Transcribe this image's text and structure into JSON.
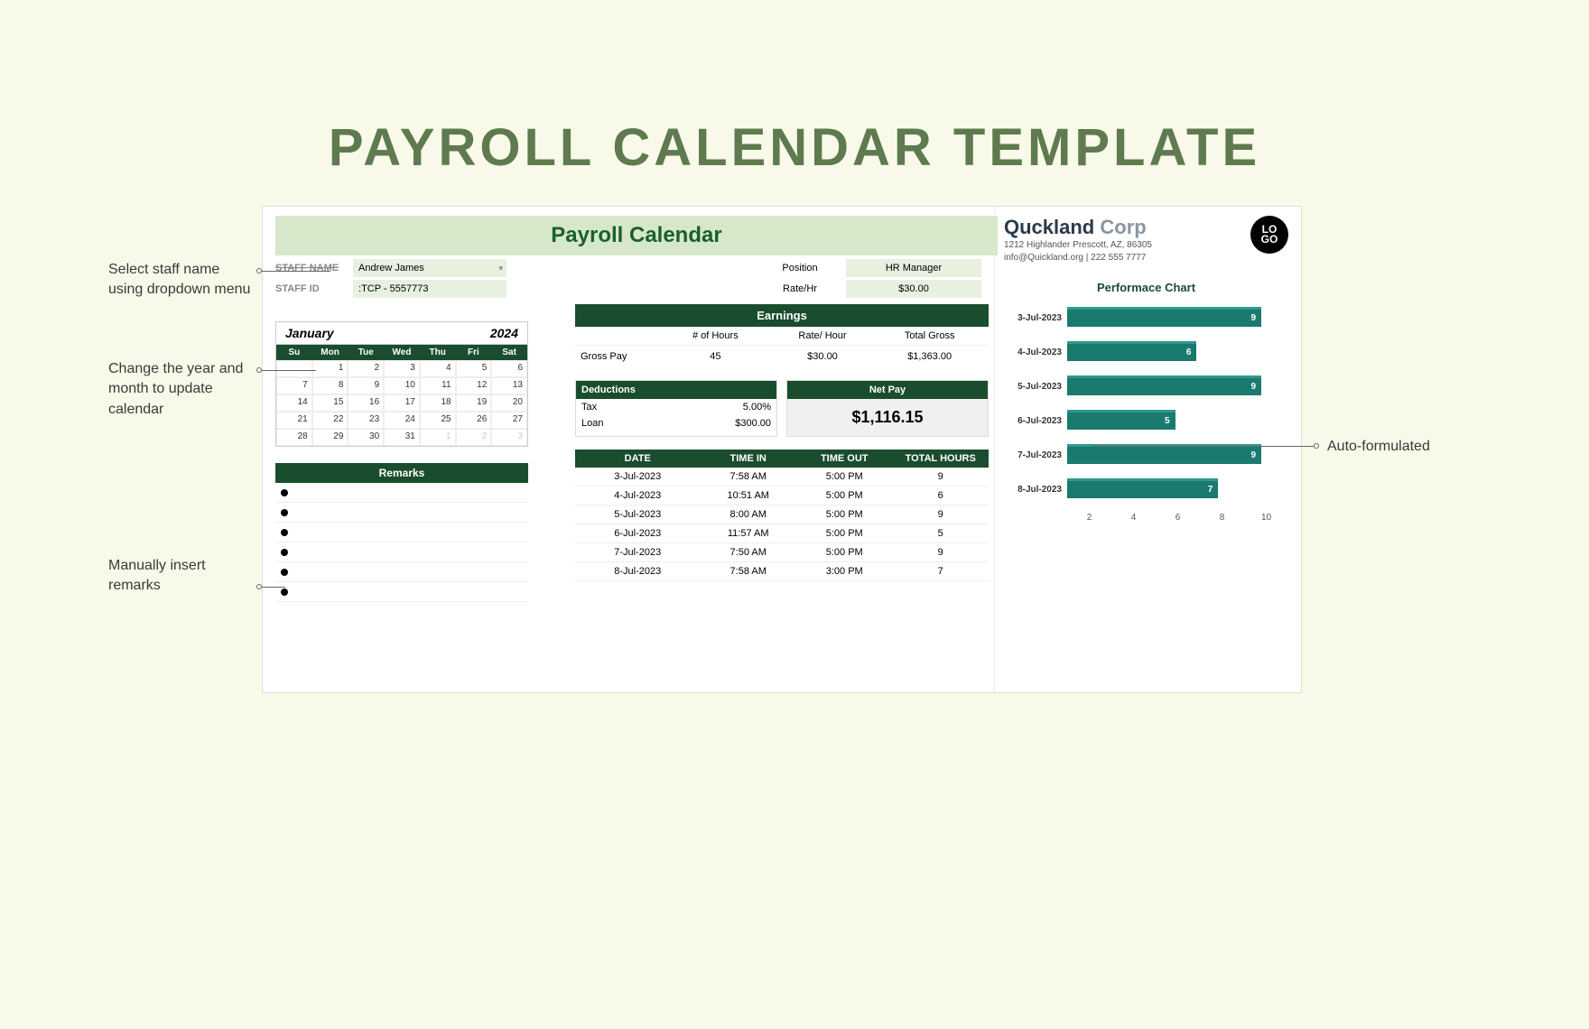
{
  "page_title": "PAYROLL CALENDAR TEMPLATE",
  "banner": "Payroll Calendar",
  "staff": {
    "name_label": "STAFF NAME",
    "name_value": "Andrew James",
    "id_label": "STAFF ID",
    "id_value": "TCP - 5557773"
  },
  "position": {
    "pos_label": "Position",
    "pos_value": "HR Manager",
    "rate_label": "Rate/Hr",
    "rate_value": "$30.00"
  },
  "calendar": {
    "month": "January",
    "year": "2024",
    "days": [
      "Su",
      "Mon",
      "Tue",
      "Wed",
      "Thu",
      "Fri",
      "Sat"
    ],
    "cells": [
      {
        "v": "",
        "d": false
      },
      {
        "v": "1",
        "d": false
      },
      {
        "v": "2",
        "d": false
      },
      {
        "v": "3",
        "d": false
      },
      {
        "v": "4",
        "d": false
      },
      {
        "v": "5",
        "d": false
      },
      {
        "v": "6",
        "d": false
      },
      {
        "v": "7",
        "d": false
      },
      {
        "v": "8",
        "d": false
      },
      {
        "v": "9",
        "d": false
      },
      {
        "v": "10",
        "d": false
      },
      {
        "v": "11",
        "d": false
      },
      {
        "v": "12",
        "d": false
      },
      {
        "v": "13",
        "d": false
      },
      {
        "v": "14",
        "d": false
      },
      {
        "v": "15",
        "d": false
      },
      {
        "v": "16",
        "d": false
      },
      {
        "v": "17",
        "d": false
      },
      {
        "v": "18",
        "d": false
      },
      {
        "v": "19",
        "d": false
      },
      {
        "v": "20",
        "d": false
      },
      {
        "v": "21",
        "d": false
      },
      {
        "v": "22",
        "d": false
      },
      {
        "v": "23",
        "d": false
      },
      {
        "v": "24",
        "d": false
      },
      {
        "v": "25",
        "d": false
      },
      {
        "v": "26",
        "d": false
      },
      {
        "v": "27",
        "d": false
      },
      {
        "v": "28",
        "d": false
      },
      {
        "v": "29",
        "d": false
      },
      {
        "v": "30",
        "d": false
      },
      {
        "v": "31",
        "d": false
      },
      {
        "v": "1",
        "d": true
      },
      {
        "v": "2",
        "d": true
      },
      {
        "v": "3",
        "d": true
      }
    ]
  },
  "remarks_title": "Remarks",
  "earnings": {
    "title": "Earnings",
    "col_hours": "# of Hours",
    "col_rate": "Rate/ Hour",
    "col_total": "Total Gross",
    "row_label": "Gross Pay",
    "hours": "45",
    "rate": "$30.00",
    "total": "$1,363.00"
  },
  "deductions": {
    "title": "Deductions",
    "tax_label": "Tax",
    "tax_value": "5.00%",
    "loan_label": "Loan",
    "loan_value": "$300.00"
  },
  "netpay": {
    "title": "Net Pay",
    "value": "$1,116.15"
  },
  "log": {
    "col_date": "DATE",
    "col_in": "TIME IN",
    "col_out": "TIME OUT",
    "col_hours": "TOTAL HOURS",
    "rows": [
      {
        "date": "3-Jul-2023",
        "in": "7:58 AM",
        "out": "5:00 PM",
        "hours": "9"
      },
      {
        "date": "4-Jul-2023",
        "in": "10:51 AM",
        "out": "5:00 PM",
        "hours": "6"
      },
      {
        "date": "5-Jul-2023",
        "in": "8:00 AM",
        "out": "5:00 PM",
        "hours": "9"
      },
      {
        "date": "6-Jul-2023",
        "in": "11:57 AM",
        "out": "5:00 PM",
        "hours": "5"
      },
      {
        "date": "7-Jul-2023",
        "in": "7:50 AM",
        "out": "5:00 PM",
        "hours": "9"
      },
      {
        "date": "8-Jul-2023",
        "in": "7:58 AM",
        "out": "3:00 PM",
        "hours": "7"
      }
    ]
  },
  "company": {
    "name1": "Quckland",
    "name2": "Corp",
    "address": "1212 Highlander Prescott, AZ, 86305",
    "contact": "info@Quickland.org | 222 555 7777",
    "logo_text1": "LO",
    "logo_text2": "GO"
  },
  "perf_title": "Performace Chart",
  "chart_data": {
    "type": "bar",
    "orientation": "horizontal",
    "title": "Performace Chart",
    "xlabel": "",
    "ylabel": "",
    "xlim": [
      0,
      10
    ],
    "x_ticks": [
      "2",
      "4",
      "6",
      "8",
      "10"
    ],
    "categories": [
      "3-Jul-2023",
      "4-Jul-2023",
      "5-Jul-2023",
      "6-Jul-2023",
      "7-Jul-2023",
      "8-Jul-2023"
    ],
    "values": [
      9,
      6,
      9,
      5,
      9,
      7
    ]
  },
  "callouts": {
    "staff": "Select staff name using dropdown menu",
    "calendar": "Change the year and month to update calendar",
    "remarks": "Manually insert remarks",
    "auto": "Auto-formulated"
  }
}
